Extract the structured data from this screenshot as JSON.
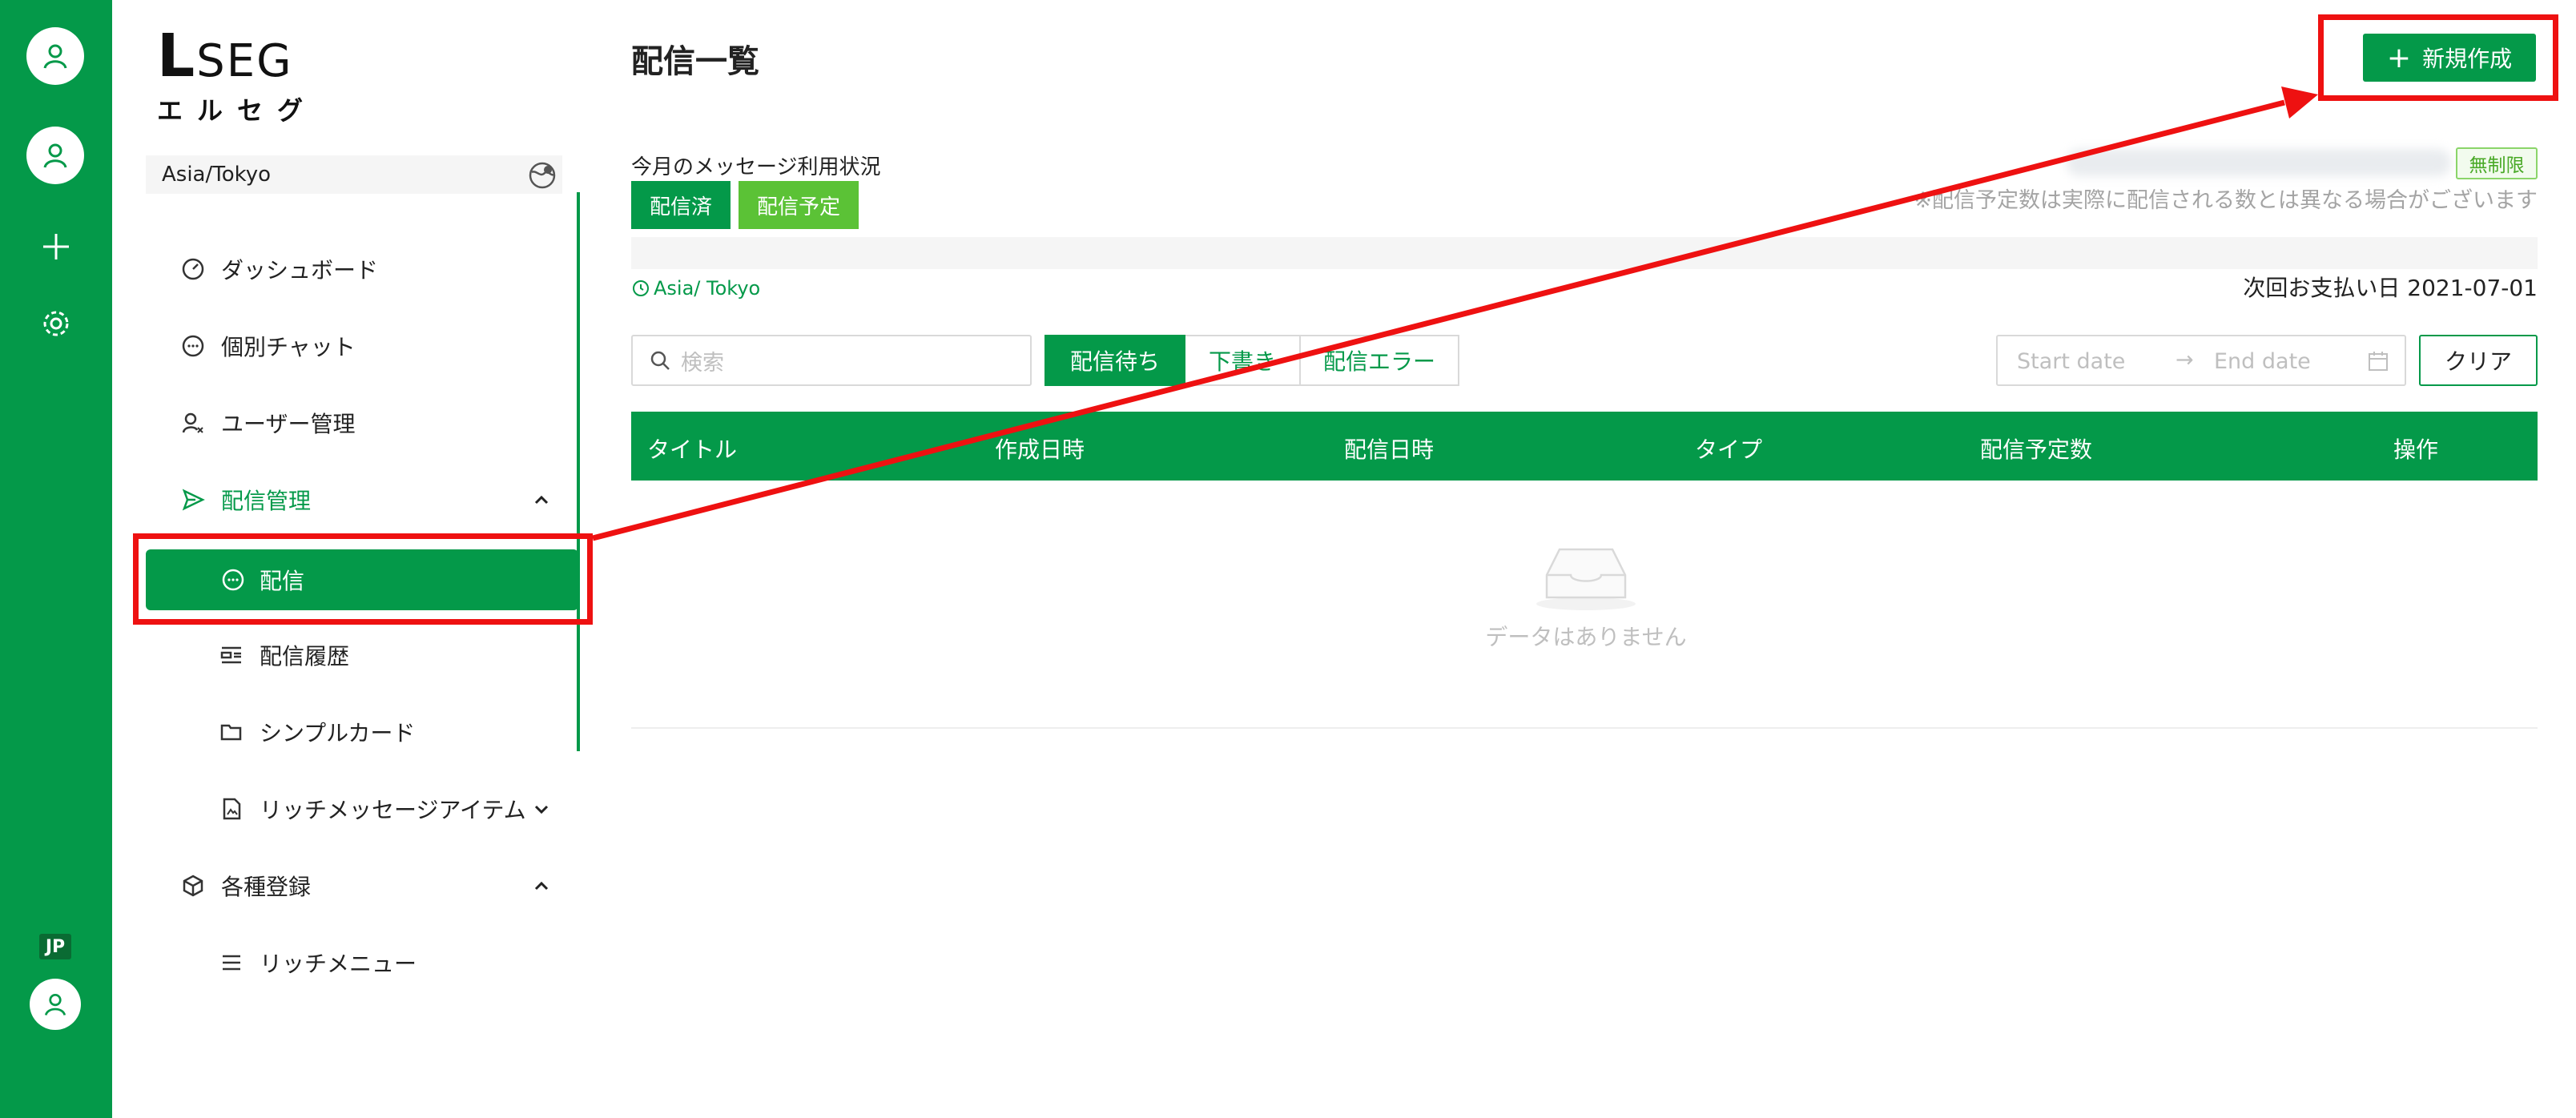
{
  "rail": {
    "jp_label": "JP"
  },
  "logo": {
    "big_letter": "L",
    "rest": "SEG",
    "sub": "エルセグ"
  },
  "sidebar": {
    "timezone": "Asia/Tokyo",
    "items": [
      {
        "label": "ダッシュボード",
        "icon": "dashboard-icon"
      },
      {
        "label": "個別チャット",
        "icon": "chat-icon"
      },
      {
        "label": "ユーザー管理",
        "icon": "users-icon"
      },
      {
        "label": "配信管理",
        "icon": "send-icon"
      },
      {
        "label": "配信",
        "icon": "chat-bubble-icon"
      },
      {
        "label": "配信履歴",
        "icon": "history-icon"
      },
      {
        "label": "シンプルカード",
        "icon": "folder-icon"
      },
      {
        "label": "リッチメッセージアイテム",
        "icon": "file-image-icon"
      },
      {
        "label": "各種登録",
        "icon": "cube-icon"
      },
      {
        "label": "リッチメニュー",
        "icon": "menu-lines-icon"
      }
    ]
  },
  "main": {
    "title": "配信一覧",
    "new_button": "新規作成",
    "usage_label": "今月のメッセージ利用状況",
    "badge_sent": "配信済",
    "badge_scheduled": "配信予定",
    "unlimited": "無制限",
    "note": "※配信予定数は実際に配信される数とは異なる場合がございます",
    "timezone_link": "Asia/ Tokyo",
    "next_payment": "次回お支払い日 2021-07-01",
    "search_placeholder": "検索",
    "tabs": [
      "配信待ち",
      "下書き",
      "配信エラー"
    ],
    "start_date_placeholder": "Start date",
    "end_date_placeholder": "End date",
    "clear_button": "クリア",
    "columns": [
      "タイトル",
      "作成日時",
      "配信日時",
      "タイプ",
      "配信予定数",
      "操作"
    ],
    "empty_text": "データはありません"
  },
  "colors": {
    "brand_green": "#049949",
    "light_green": "#5bc236",
    "annotation_red": "#ee1111"
  }
}
